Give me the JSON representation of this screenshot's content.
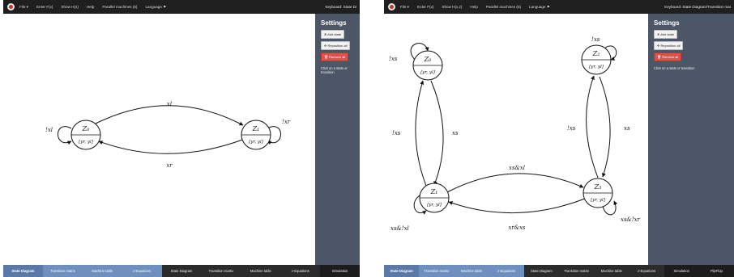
{
  "panels": [
    {
      "topbar": {
        "menu": [
          "File ▾",
          "Enter F(x)",
          "Show H(x)",
          "Help",
          "Parallel machines (5)",
          "Language ⚑"
        ],
        "hint": "Keyboard: State Di"
      },
      "settings": {
        "title": "Settings",
        "add_state": "⊕ Add state",
        "reposition": "✣ Reposition all",
        "remove_all": "🗑 Remove all",
        "note": "Click on a state or transition"
      },
      "states": [
        {
          "name": "Z₀",
          "output": "[yr, yl]"
        },
        {
          "name": "Z₁",
          "output": "[yr, yl]"
        }
      ],
      "labels": {
        "z0_loop": "!xl",
        "z1_loop": "!xr",
        "top": "xl",
        "bottom": "xr"
      },
      "tabs": [
        "State Diagram",
        "Transition matrix",
        "Machine table",
        "z-Equations",
        "State Diagram",
        "Transition matrix",
        "Machine table",
        "z-Equations",
        "Simulation"
      ]
    },
    {
      "topbar": {
        "menu": [
          "File ▾",
          "Enter F(x)",
          "Show H(x,z)",
          "Help",
          "Parallel machines (5)",
          "Language ⚑"
        ],
        "hint": "Keyboard: State Diagram/Transition mat"
      },
      "settings": {
        "title": "Settings",
        "add_state": "⊕ Add state",
        "reposition": "✣ Reposition all",
        "remove_all": "🗑 Remove all",
        "note": "Click on a state or transition"
      },
      "states": [
        {
          "name": "Z₀",
          "output": "[yr, yl]"
        },
        {
          "name": "Z₁",
          "output": "[yr, yl]"
        },
        {
          "name": "Z₂",
          "output": "[yr, yl]"
        },
        {
          "name": "Z₃",
          "output": "[yr, yl]"
        }
      ],
      "labels": {
        "z0_loop": "!xs",
        "z2_loop": "!xs",
        "z1_loop": "xs&!xl",
        "z3_loop": "xs&!xr",
        "z0_z1_left": "!xs",
        "z0_z1_right": "xs",
        "z2_z3_left": "!xs",
        "z2_z3_right": "xs",
        "top": "xs&xl",
        "bottom": "xr&xs"
      },
      "tabs": [
        "State Diagram",
        "Transition matrix",
        "Machine table",
        "z-Equations",
        "State Diagram",
        "Transition matrix",
        "Machine table",
        "z-Equations",
        "Simulation",
        "FlipFlop"
      ]
    }
  ]
}
